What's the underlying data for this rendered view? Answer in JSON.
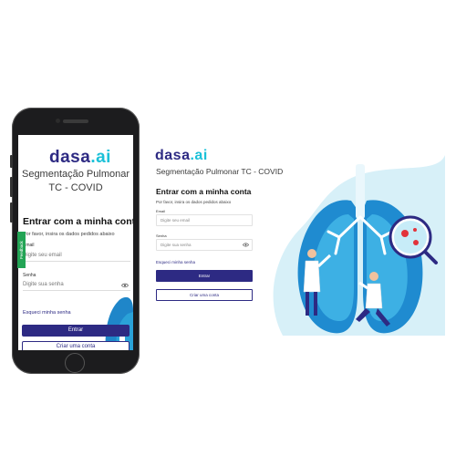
{
  "brand": {
    "name": "dasa",
    "suffix": "ai",
    "primary_color": "#2d2a83",
    "accent_color": "#1bc1d8"
  },
  "app": {
    "subtitle_line1": "Segmentação Pulmonar",
    "subtitle_line2": "TC - COVID",
    "subtitle": "Segmentação Pulmonar TC - COVID"
  },
  "login": {
    "heading": "Entrar com a minha conta",
    "description": "Por favor, insira os dados pedidos abaixo",
    "email_label": "Email",
    "email_placeholder": "Digite seu email",
    "password_label": "Senha",
    "password_placeholder": "Digite sua senha",
    "forgot_link": "Esqueci minha senha",
    "enter_button": "Entrar",
    "create_button": "Criar uma conta"
  },
  "feedback_tab": {
    "label": "Feedback"
  },
  "icons": {
    "password_toggle": "eye-icon",
    "illustration": "lungs-doctors-illustration"
  }
}
